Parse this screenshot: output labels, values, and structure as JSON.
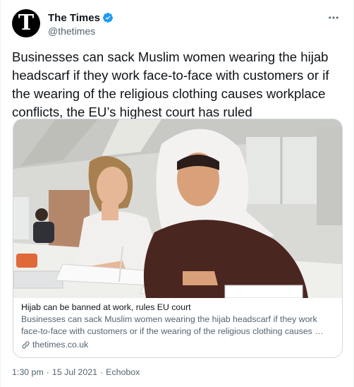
{
  "account": {
    "name": "The Times",
    "handle": "@thetimes",
    "avatar_letter": "T",
    "verified_color": "#1d9bf0"
  },
  "tweet": {
    "text": "Businesses can sack Muslim women wearing the hijab headscarf if they work face-to-face with customers or if the wearing of the religious clothing causes workplace conflicts, the EU’s highest court has ruled"
  },
  "card": {
    "image_icon": "photo-women-writing",
    "title": "Hijab can be banned at work, rules EU court",
    "description": "Businesses can sack Muslim women wearing the hijab headscarf if they work face-to-face with customers or if the wearing of the religious clothing causes …",
    "domain": "thetimes.co.uk"
  },
  "meta": {
    "time": "1:30 pm",
    "date": "15 Jul 2021",
    "source": "Echobox",
    "separator": "·"
  }
}
